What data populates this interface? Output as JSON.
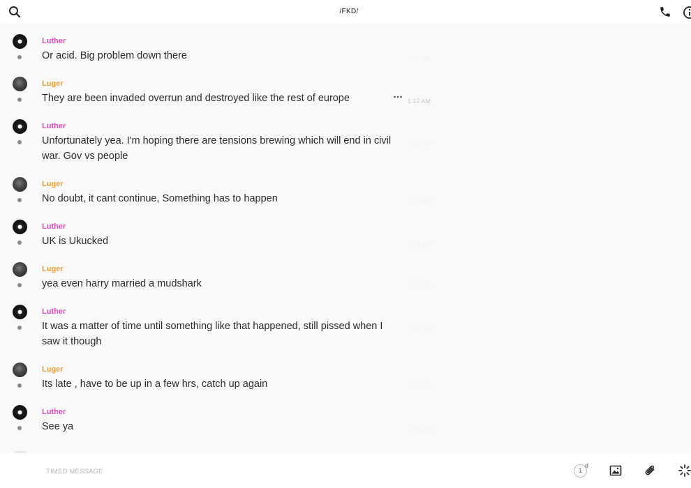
{
  "header": {
    "title": "/FKD/",
    "left_icon": "search-icon",
    "right_icons": [
      "phone-icon",
      "info-icon"
    ]
  },
  "colors": {
    "luther": "#e14fb7",
    "luger": "#f0a03a",
    "background": "#f9f9fa"
  },
  "messages": [
    {
      "author": "Luther",
      "text": "Or acid. Big problem down there",
      "time": "1:11 AM"
    },
    {
      "author": "Luger",
      "text": "They are been invaded overrun and destroyed like the rest of europe",
      "time": "1:12 AM"
    },
    {
      "author": "Luther",
      "text": "Unfortunately yea. I'm hoping there are tensions brewing which will end in civil war. Gov vs people",
      "time": "1:12 AM"
    },
    {
      "author": "Luger",
      "text": "No doubt, it cant continue, Something has to happen",
      "time": "1:13 AM"
    },
    {
      "author": "Luther",
      "text": "UK is Ukucked",
      "time": "1:13 AM"
    },
    {
      "author": "Luger",
      "text": "yea even harry married a mudshark",
      "time": "1:14 AM"
    },
    {
      "author": "Luther",
      "text": "It was a matter of time until something like that happened, still pissed when I saw it though",
      "time": "1:14 AM"
    },
    {
      "author": "Luger",
      "text": "Its late , have to be up in a few hrs, catch up again",
      "time": "1:15 AM"
    },
    {
      "author": "Luther",
      "text": "See ya",
      "time": "1:15 AM"
    }
  ],
  "composer": {
    "placeholder": "TIMED MESSAGE",
    "timer_value": "1",
    "timer_unit": "d",
    "icons": [
      "timer-icon",
      "image-icon",
      "paperclip-icon",
      "loading-icon"
    ]
  }
}
